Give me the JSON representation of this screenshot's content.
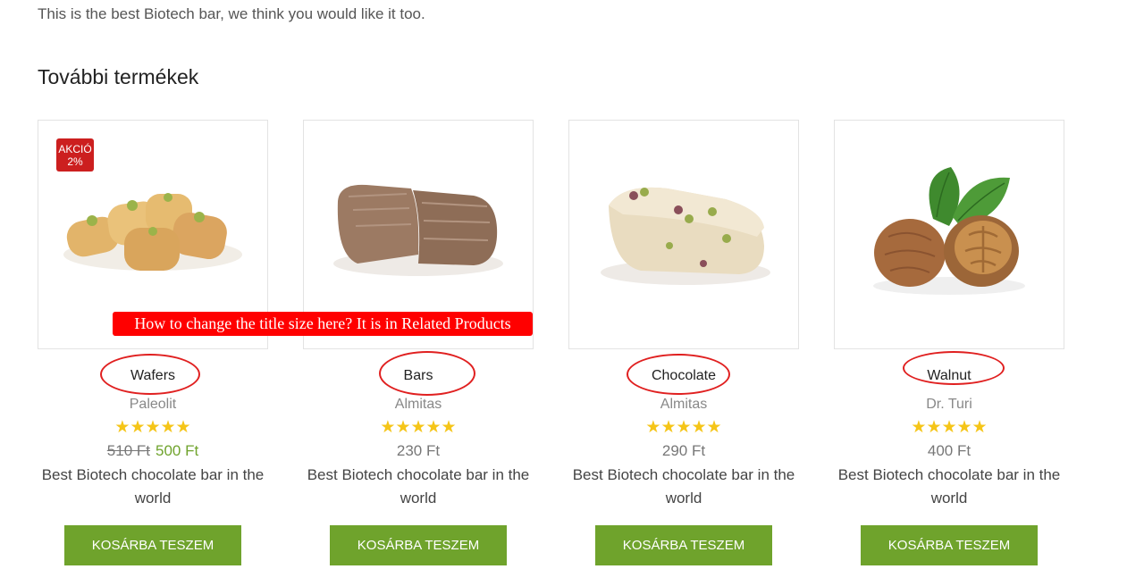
{
  "intro_text": "This is the best Biotech bar, we think you would like it too.",
  "section_title": "További termékek",
  "products": [
    {
      "title": "Wafers",
      "brand": "Paleolit",
      "rating": 5,
      "stars": "★★★★★",
      "old_price": "510 Ft",
      "price": "500 Ft",
      "badge_line1": "AKCIÓ",
      "badge_line2": "2%",
      "description": "Best Biotech chocolate bar in the world",
      "button": "Kosárba teszem",
      "image": "baklava-image"
    },
    {
      "title": "Bars",
      "brand": "Almitas",
      "rating": 5,
      "stars": "★★★★★",
      "price": "230 Ft",
      "description": "Best Biotech chocolate bar in the world",
      "button": "Kosárba teszem",
      "image": "chocolate-halva-image"
    },
    {
      "title": "Chocolate",
      "brand": "Almitas",
      "rating": 5,
      "stars": "★★★★★",
      "price": "290 Ft",
      "description": "Best Biotech chocolate bar in the world",
      "button": "Kosárba teszem",
      "image": "pistachio-halva-image"
    },
    {
      "title": "Walnut",
      "brand": "Dr. Turi",
      "rating": 5,
      "stars": "★★★★★",
      "price": "400 Ft",
      "description": "Best Biotech chocolate bar in the world",
      "button": "Kosárba teszem",
      "image": "walnut-image"
    }
  ],
  "annotation_text": "How to change the title size here? It is in Related Products",
  "colors": {
    "accent_green": "#6fa32c",
    "badge_red": "#cc1f1f",
    "annotation_red": "#ff0000",
    "star_yellow": "#f5c518"
  }
}
